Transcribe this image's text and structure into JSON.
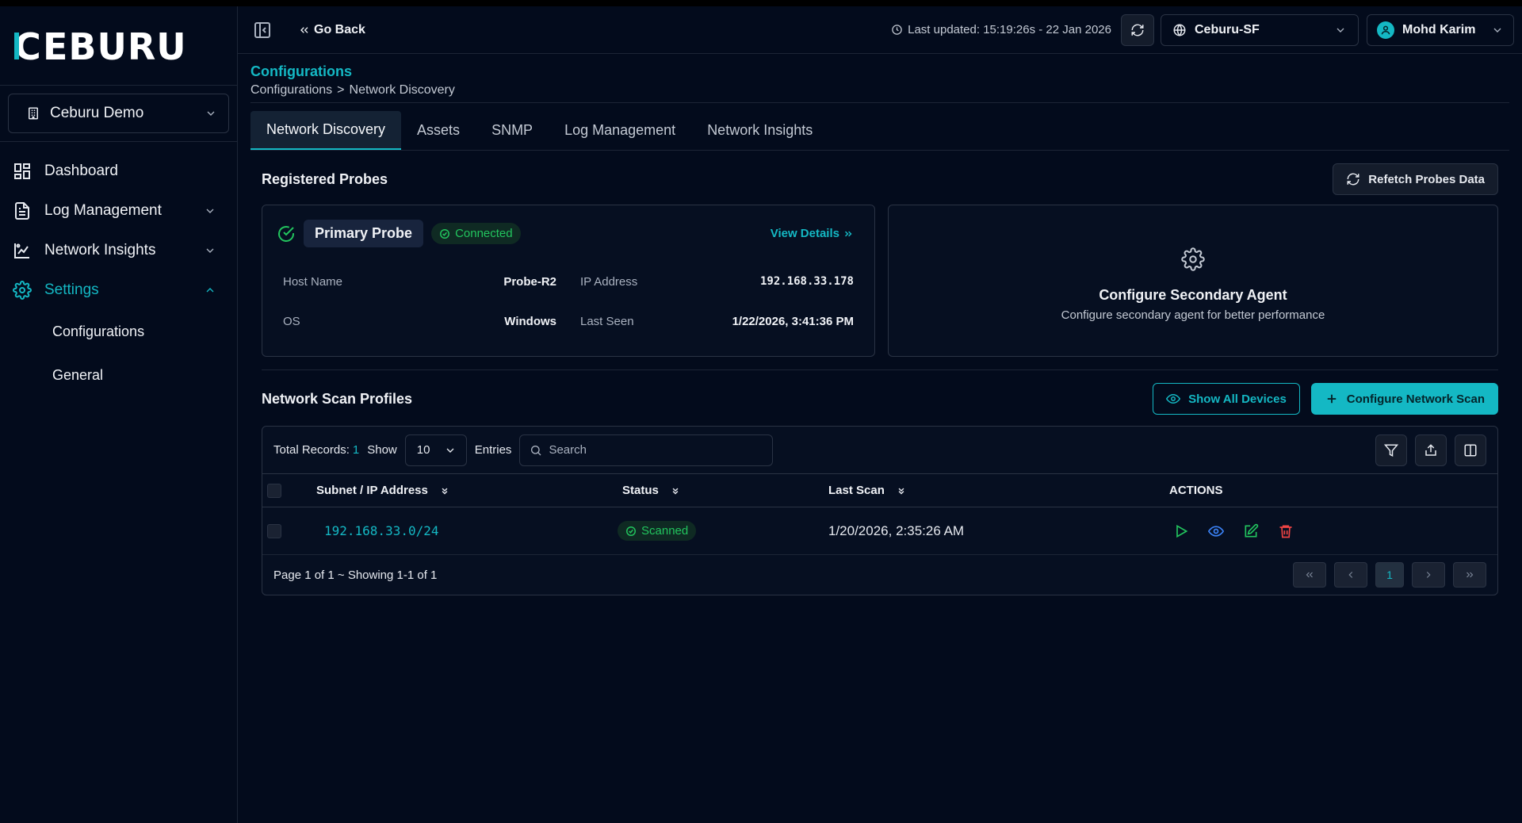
{
  "brand": {
    "logo_text": "CEBURU",
    "accent": "#14b8c4"
  },
  "sidebar": {
    "tenant": "Ceburu Demo",
    "items": [
      {
        "label": "Dashboard",
        "icon": "dashboard-icon"
      },
      {
        "label": "Log Management",
        "icon": "document-icon"
      },
      {
        "label": "Network Insights",
        "icon": "chart-icon"
      },
      {
        "label": "Settings",
        "icon": "gear-icon"
      }
    ],
    "sub_items": [
      {
        "label": "Configurations"
      },
      {
        "label": "General"
      }
    ]
  },
  "topbar": {
    "go_back": "Go Back",
    "last_updated": "Last updated: 15:19:26s - 22 Jan 2026",
    "site": "Ceburu-SF",
    "user": "Mohd Karim"
  },
  "header": {
    "title": "Configurations",
    "breadcrumb": [
      "Configurations",
      ">",
      "Network Discovery"
    ]
  },
  "tabs": [
    {
      "label": "Network Discovery",
      "active": true
    },
    {
      "label": "Assets"
    },
    {
      "label": "SNMP"
    },
    {
      "label": "Log Management"
    },
    {
      "label": "Network Insights"
    }
  ],
  "probes": {
    "section_title": "Registered Probes",
    "refetch_label": "Refetch Probes Data",
    "primary": {
      "name": "Primary Probe",
      "status": "Connected",
      "view_details": "View Details",
      "host_name_label": "Host Name",
      "host_name": "Probe-R2",
      "ip_label": "IP Address",
      "ip": "192.168.33.178",
      "os_label": "OS",
      "os": "Windows",
      "last_seen_label": "Last Seen",
      "last_seen": "1/22/2026, 3:41:36 PM"
    },
    "secondary": {
      "title": "Configure Secondary Agent",
      "subtitle": "Configure secondary agent for better performance"
    }
  },
  "scan_profiles": {
    "section_title": "Network Scan Profiles",
    "show_all_label": "Show All Devices",
    "configure_label": "Configure Network Scan",
    "total_label": "Total Records:",
    "total_count": "1",
    "show_label": "Show",
    "page_size": "10",
    "entries_label": "Entries",
    "search_placeholder": "Search",
    "columns": {
      "subnet": "Subnet / IP Address",
      "status": "Status",
      "last_scan": "Last Scan",
      "actions": "ACTIONS"
    },
    "rows": [
      {
        "subnet": "192.168.33.0/24",
        "status": "Scanned",
        "last_scan": "1/20/2026, 2:35:26 AM"
      }
    ],
    "footer_text": "Page 1 of 1 ~ Showing 1-1 of 1",
    "current_page": "1"
  }
}
